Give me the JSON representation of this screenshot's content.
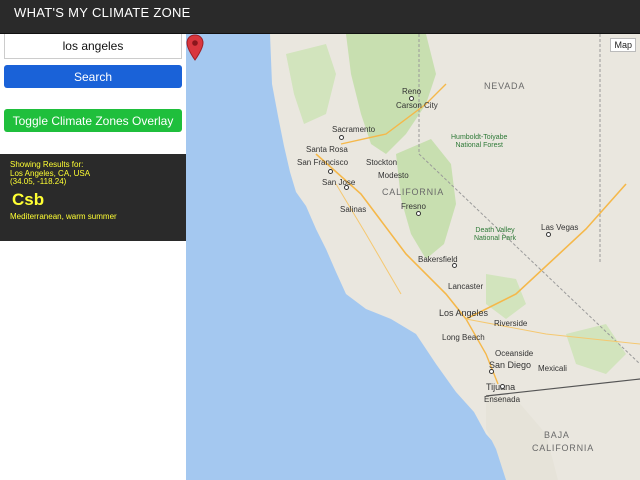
{
  "header": {
    "title": "WHAT'S MY CLIMATE ZONE"
  },
  "search": {
    "value": "los angeles",
    "button_label": "Search"
  },
  "overlay": {
    "button_label": "Toggle Climate Zones Overlay"
  },
  "results": {
    "heading": "Showing Results for:",
    "location": "Los Angeles, CA, USA",
    "coords": "(34.05, -118.24)",
    "zone": "Csb",
    "description": "Mediterranean, warm summer"
  },
  "map": {
    "type_button": "Map",
    "regions": {
      "nevada": "NEVADA",
      "california": "CALIFORNIA",
      "baja": "BAJA",
      "baja2": "CALIFORNIA"
    },
    "cities": {
      "reno": "Reno",
      "carson_city": "Carson City",
      "sacramento": "Sacramento",
      "santa_rosa": "Santa Rosa",
      "stockton": "Stockton",
      "san_francisco": "San Francisco",
      "modesto": "Modesto",
      "san_jose": "San Jose",
      "salinas": "Salinas",
      "fresno": "Fresno",
      "bakersfield": "Bakersfield",
      "las_vegas": "Las Vegas",
      "lancaster": "Lancaster",
      "los_angeles": "Los Angeles",
      "riverside": "Riverside",
      "long_beach": "Long Beach",
      "oceanside": "Oceanside",
      "san_diego": "San Diego",
      "mexicali": "Mexicali",
      "tijuana": "Tijuana",
      "ensenada": "Ensenada"
    },
    "parks": {
      "humboldt": "Humboldt-Toiyabe\nNational Forest",
      "death_valley": "Death Valley\nNational Park"
    },
    "colors": {
      "ocean": "#a4c8f0",
      "land": "#eae7df",
      "forest": "#c8dfb0",
      "highway": "#f5b84a",
      "pin": "#d9363e"
    }
  }
}
